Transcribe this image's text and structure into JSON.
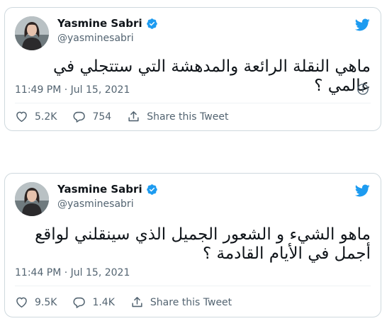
{
  "colors": {
    "brand_blue": "#1d9bf0",
    "secondary_text": "#536471",
    "primary_text": "#0f1419",
    "border": "#cfd9de"
  },
  "tweets": [
    {
      "author": {
        "name": "Yasmine Sabri",
        "handle": "@yasminesabri",
        "verified": true
      },
      "text": "ماهي النقلة الرائعة والمدهشة التي ستتجلي في عالمي ؟",
      "timestamp": "11:49 PM · Jul 15, 2021",
      "likes": "5.2K",
      "replies": "754",
      "share_label": "Share this Tweet",
      "icons": [
        "avatar",
        "verified-badge-icon",
        "twitter-bird-icon",
        "info-icon",
        "heart-icon",
        "reply-icon",
        "share-icon"
      ]
    },
    {
      "author": {
        "name": "Yasmine Sabri",
        "handle": "@yasminesabri",
        "verified": true
      },
      "text": "ماهو الشيء و الشعور الجميل الذي سينقلني لواقع أجمل في الأيام القادمة ؟",
      "timestamp": "11:44 PM · Jul 15, 2021",
      "likes": "9.5K",
      "replies": "1.4K",
      "share_label": "Share this Tweet",
      "icons": [
        "avatar",
        "verified-badge-icon",
        "twitter-bird-icon",
        "heart-icon",
        "reply-icon",
        "share-icon"
      ]
    }
  ]
}
